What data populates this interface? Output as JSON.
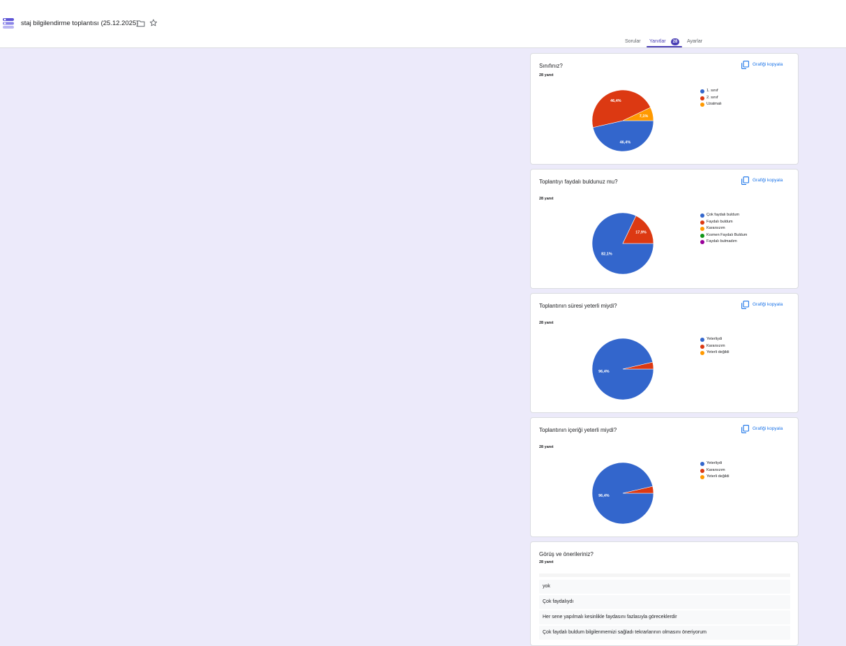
{
  "header": {
    "title": "staj bilgilendirme toplantısı (25.12.2025)",
    "icons": [
      "forms-app-icon",
      "folder-icon",
      "star-icon"
    ]
  },
  "tabs": [
    {
      "label": "Sorular",
      "active": false
    },
    {
      "label": "Yanıtlar",
      "active": true,
      "badge": "28"
    },
    {
      "label": "Ayarlar",
      "active": false
    }
  ],
  "copy_label": "Grafiği kopyala",
  "colors": {
    "background": "#eceafa",
    "accent": "#4a3fb5",
    "link": "#1a73e8",
    "series": [
      "#3366cc",
      "#dc3912",
      "#ff9900",
      "#109618",
      "#990099"
    ]
  },
  "questions": [
    {
      "title": "Sınıfınız?",
      "count": "28 yanıt",
      "legend": [
        "1. sınıf",
        "2. sınıf",
        "Uzatmalı"
      ],
      "slice_labels": [
        "46,4%",
        "46,4%",
        "7,1%"
      ]
    },
    {
      "title": "Toplantıyı faydalı buldunuz mu?",
      "count": "28 yanıt",
      "legend": [
        "Çok faydalı buldum",
        "Faydalı buldum",
        "Kararsızım",
        "Kısmen Faydalı Buldum",
        "Faydalı bulmadım"
      ],
      "slice_labels": [
        "82,1%",
        "17,9%"
      ]
    },
    {
      "title": "Toplantının süresi yeterli miydi?",
      "count": "28 yanıt",
      "legend": [
        "Yeterliydi",
        "Kararsızım",
        "Yeterli değildi"
      ],
      "slice_labels": [
        "96,4%"
      ]
    },
    {
      "title": "Toplantının içeriği yeterli miydi?",
      "count": "28 yanıt",
      "legend": [
        "Yeterliydi",
        "Kararsızım",
        "Yeterli değildi"
      ],
      "slice_labels": [
        "96,4%"
      ]
    },
    {
      "title": "Görüş ve önerileriniz?",
      "count": "28 yanıt",
      "answers": [
        "yok",
        "Çok faydalıydı",
        "Her sene yapılmalı kesinlikle faydasını fazlasıyla göreceklerdir",
        "Çok faydalı buldum bilgilenmemizi sağladı tekrarlarının olmasını öneriyorum"
      ]
    }
  ],
  "chart_data": [
    {
      "type": "pie",
      "title": "Sınıfınız?",
      "categories": [
        "1. sınıf",
        "2. sınıf",
        "Uzatmalı"
      ],
      "values": [
        46.4,
        46.4,
        7.1
      ],
      "legend": "right"
    },
    {
      "type": "pie",
      "title": "Toplantıyı faydalı buldunuz mu?",
      "categories": [
        "Çok faydalı buldum",
        "Faydalı buldum",
        "Kararsızım",
        "Kısmen Faydalı Buldum",
        "Faydalı bulmadım"
      ],
      "values": [
        82.1,
        17.9,
        0,
        0,
        0
      ],
      "legend": "right"
    },
    {
      "type": "pie",
      "title": "Toplantının süresi yeterli miydi?",
      "categories": [
        "Yeterliydi",
        "Kararsızım",
        "Yeterli değildi"
      ],
      "values": [
        96.4,
        3.6,
        0
      ],
      "legend": "right"
    },
    {
      "type": "pie",
      "title": "Toplantının içeriği yeterli miydi?",
      "categories": [
        "Yeterliydi",
        "Kararsızım",
        "Yeterli değildi"
      ],
      "values": [
        96.4,
        3.6,
        0
      ],
      "legend": "right"
    }
  ]
}
